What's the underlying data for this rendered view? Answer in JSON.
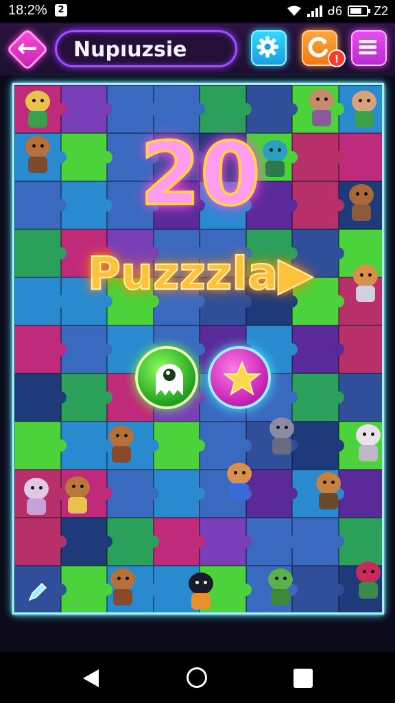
{
  "status_bar": {
    "time": "18:2%",
    "carrier": "ᑯ6",
    "battery_label": "Z2"
  },
  "header": {
    "title": "Nupıuzsie",
    "back_icon": "arrow-left-icon",
    "settings_icon": "gear-icon",
    "refresh_icon": "refresh-icon",
    "menu_icon": "hamburger-menu-icon",
    "notification_count": "!"
  },
  "level": {
    "number": "20",
    "name": "Puzzzla▶"
  },
  "actions": {
    "ghost_icon": "ghost-icon",
    "star_icon": "star-icon",
    "edit_icon": "pencil-icon"
  },
  "colors": {
    "accent_pink": "#ff4fd8",
    "accent_cyan": "#32d8ff",
    "accent_orange": "#ffa63a",
    "accent_green": "#4cd23a"
  },
  "nav": {
    "back_icon": "triangle-back-icon",
    "home_icon": "circle-home-icon",
    "recents_icon": "square-recents-icon"
  }
}
